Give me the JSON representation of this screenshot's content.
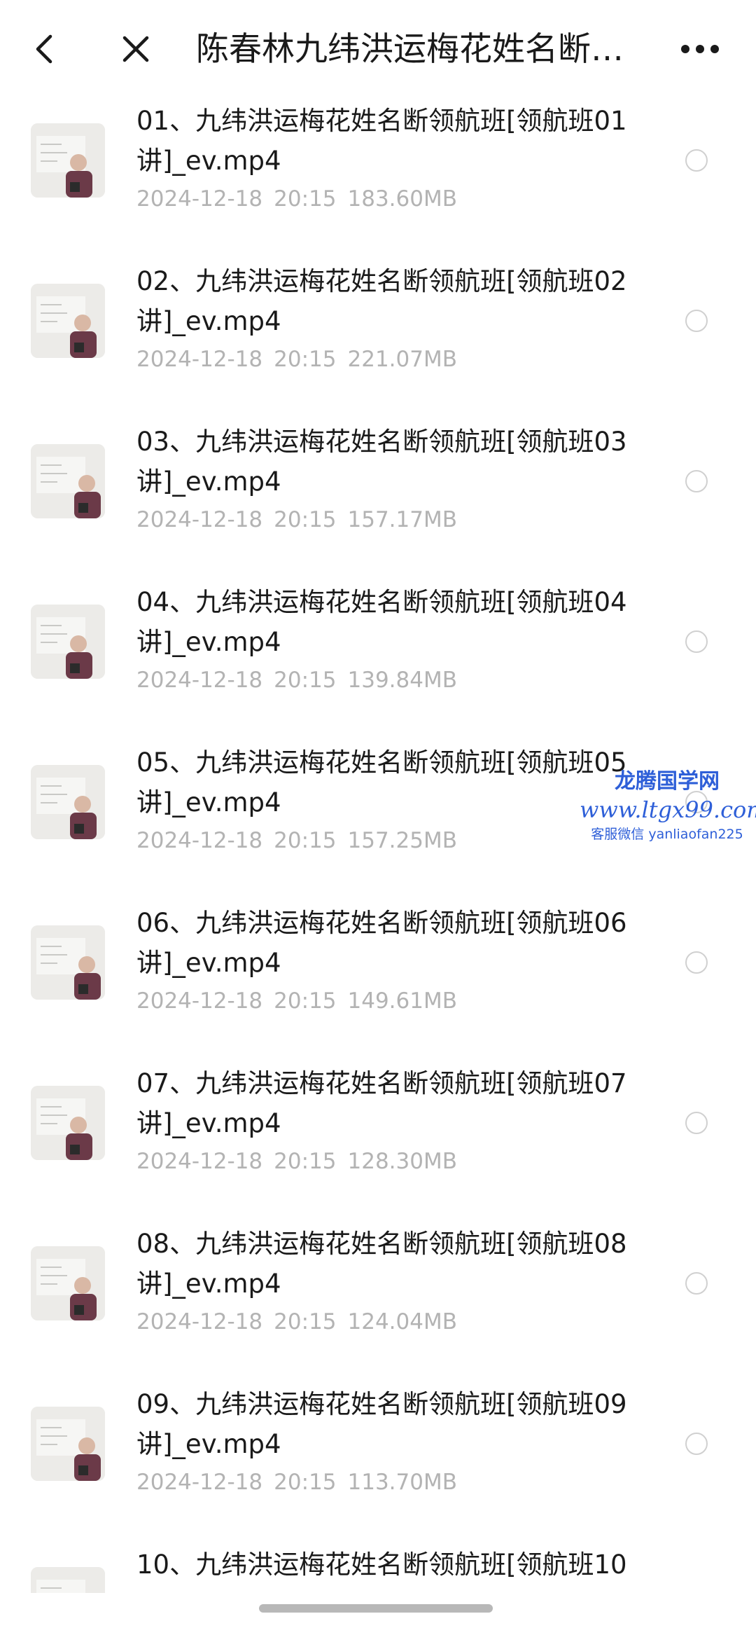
{
  "header": {
    "title": "陈春林九纬洪运梅花姓名断领航班",
    "back_icon": "chevron-left-icon",
    "close_icon": "close-icon",
    "more_icon": "more-horizontal-icon"
  },
  "files": [
    {
      "name": "01、九纬洪运梅花姓名断领航班[领航班01讲]_ev.mp4",
      "date": "2024-12-18",
      "time": "20:15",
      "size": "183.60MB"
    },
    {
      "name": "02、九纬洪运梅花姓名断领航班[领航班02讲]_ev.mp4",
      "date": "2024-12-18",
      "time": "20:15",
      "size": "221.07MB"
    },
    {
      "name": "03、九纬洪运梅花姓名断领航班[领航班03讲]_ev.mp4",
      "date": "2024-12-18",
      "time": "20:15",
      "size": "157.17MB"
    },
    {
      "name": "04、九纬洪运梅花姓名断领航班[领航班04讲]_ev.mp4",
      "date": "2024-12-18",
      "time": "20:15",
      "size": "139.84MB"
    },
    {
      "name": "05、九纬洪运梅花姓名断领航班[领航班05讲]_ev.mp4",
      "date": "2024-12-18",
      "time": "20:15",
      "size": "157.25MB"
    },
    {
      "name": "06、九纬洪运梅花姓名断领航班[领航班06讲]_ev.mp4",
      "date": "2024-12-18",
      "time": "20:15",
      "size": "149.61MB"
    },
    {
      "name": "07、九纬洪运梅花姓名断领航班[领航班07讲]_ev.mp4",
      "date": "2024-12-18",
      "time": "20:15",
      "size": "128.30MB"
    },
    {
      "name": "08、九纬洪运梅花姓名断领航班[领航班08讲]_ev.mp4",
      "date": "2024-12-18",
      "time": "20:15",
      "size": "124.04MB"
    },
    {
      "name": "09、九纬洪运梅花姓名断领航班[领航班09讲]_ev.mp4",
      "date": "2024-12-18",
      "time": "20:15",
      "size": "113.70MB"
    },
    {
      "name": "10、九纬洪运梅花姓名断领航班[领航班10",
      "date": "",
      "time": "",
      "size": ""
    }
  ],
  "watermark": {
    "line1": "龙腾国学网",
    "line2": "www.ltgx99.com",
    "line3": "客服微信 yanliaofan225"
  },
  "colors": {
    "text_primary": "#1a1a1a",
    "text_meta": "#b3b3b3",
    "watermark": "#2e5fd8",
    "radio_border": "#d0d0d0"
  }
}
